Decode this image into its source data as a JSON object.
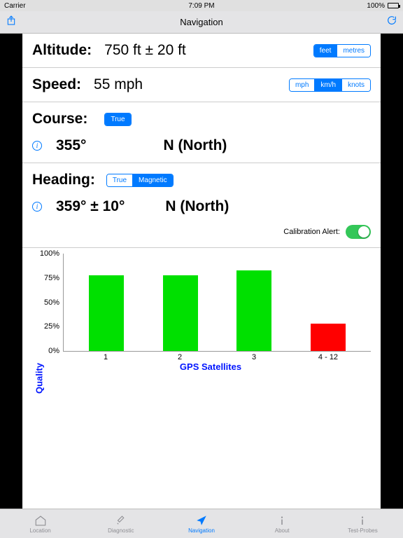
{
  "statusbar": {
    "carrier": "Carrier",
    "wifi": "ᯤ",
    "time": "7:09 PM",
    "battery_pct": "100%"
  },
  "navbar": {
    "title": "Navigation"
  },
  "altitude": {
    "label": "Altitude:",
    "value": "750 ft ± 20 ft",
    "units": [
      {
        "label": "feet",
        "selected": true
      },
      {
        "label": "metres",
        "selected": false
      }
    ]
  },
  "speed": {
    "label": "Speed:",
    "value": "55 mph",
    "units": [
      {
        "label": "mph",
        "selected": false
      },
      {
        "label": "km/h",
        "selected": true
      },
      {
        "label": "knots",
        "selected": false
      }
    ]
  },
  "course": {
    "label": "Course:",
    "mode": [
      {
        "label": "True",
        "selected": true
      }
    ],
    "degrees": "355°",
    "direction": "N (North)"
  },
  "heading": {
    "label": "Heading:",
    "mode": [
      {
        "label": "True",
        "selected": false
      },
      {
        "label": "Magnetic",
        "selected": true
      }
    ],
    "degrees": "359° ± 10°",
    "direction": "N (North)",
    "calibration_label": "Calibration Alert:",
    "calibration_on": true
  },
  "tabs": [
    {
      "label": "Location",
      "active": false
    },
    {
      "label": "Diagnostic",
      "active": false
    },
    {
      "label": "Navigation",
      "active": true
    },
    {
      "label": "About",
      "active": false
    },
    {
      "label": "Test-Probes",
      "active": false
    }
  ],
  "chart_data": {
    "type": "bar",
    "title": "",
    "xlabel": "GPS Satellites",
    "ylabel": "Quality",
    "ylim": [
      0,
      100
    ],
    "yticks": [
      "0%",
      "25%",
      "50%",
      "75%",
      "100%"
    ],
    "categories": [
      "1",
      "2",
      "3",
      "4 - 12"
    ],
    "values": [
      78,
      78,
      83,
      28
    ],
    "colors": [
      "#00e000",
      "#00e000",
      "#00e000",
      "#ff0000"
    ]
  }
}
